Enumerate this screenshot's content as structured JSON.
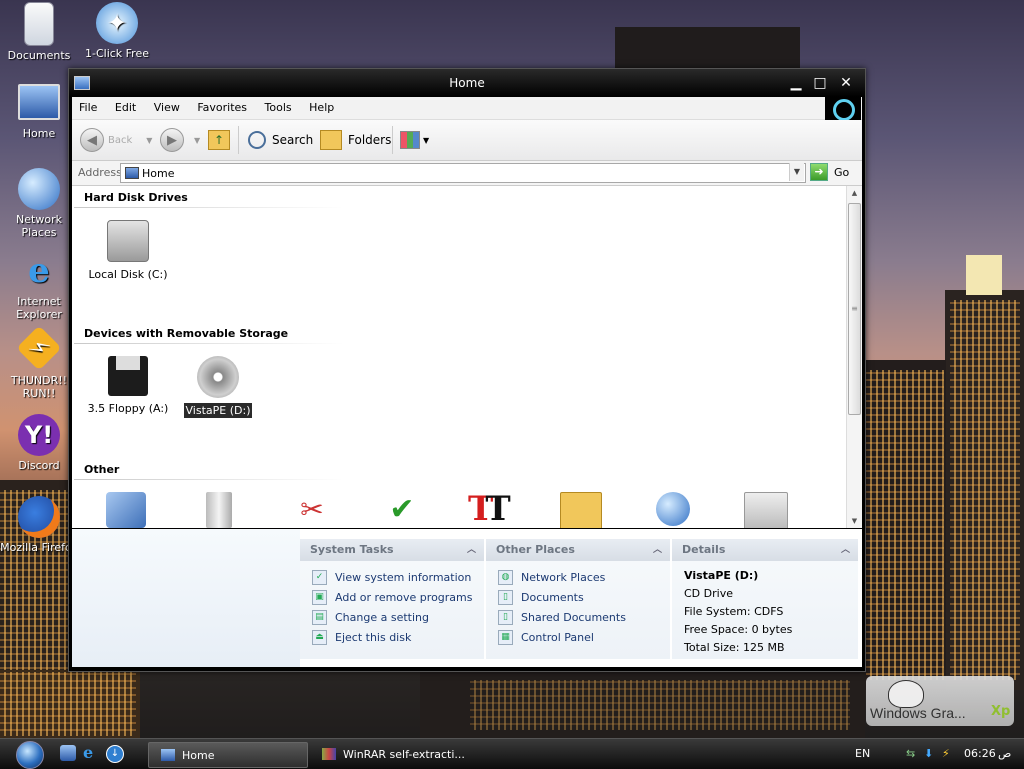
{
  "desktop": {
    "icons": [
      {
        "label": "Documents"
      },
      {
        "label": "1-Click Free"
      },
      {
        "label": "Home"
      },
      {
        "label": "Network Places"
      },
      {
        "label": "Internet Explorer"
      },
      {
        "label": "THUNDR!! RUN!!"
      },
      {
        "label": "Discord"
      },
      {
        "label": "Mozilla Firefox"
      }
    ],
    "watermark": {
      "text": "Windows Gra...",
      "xp": "Xp"
    }
  },
  "window": {
    "title": "Home",
    "controls": {
      "minimize": "▁",
      "maximize": "□",
      "close": "✕"
    },
    "menu": [
      "File",
      "Edit",
      "View",
      "Favorites",
      "Tools",
      "Help"
    ],
    "toolbar": {
      "back": "Back",
      "search": "Search",
      "folders": "Folders"
    },
    "address": {
      "label": "Address",
      "value": "Home",
      "go": "Go"
    },
    "sections": [
      {
        "title": "Hard Disk Drives",
        "items": [
          {
            "label": "Local Disk (C:)",
            "icon": "hard-disk-icon"
          }
        ]
      },
      {
        "title": "Devices with Removable Storage",
        "items": [
          {
            "label": "3.5 Floppy (A:)",
            "icon": "floppy-icon"
          },
          {
            "label": "VistaPE (D:)",
            "icon": "cd-drive-icon",
            "selected": true
          }
        ]
      },
      {
        "title": "Other",
        "items": [
          {
            "icon": "control-panel-icon"
          },
          {
            "icon": "recycle-bin-icon"
          },
          {
            "icon": "tools-icon"
          },
          {
            "icon": "checkmark-icon"
          },
          {
            "icon": "fonts-icon"
          },
          {
            "icon": "shared-folder-icon"
          },
          {
            "icon": "network-globe-icon"
          },
          {
            "icon": "printer-icon"
          }
        ]
      }
    ],
    "system_tasks": {
      "title": "System Tasks",
      "items": [
        "View system information",
        "Add or remove programs",
        "Change a setting",
        "Eject this disk"
      ]
    },
    "other_places": {
      "title": "Other Places",
      "items": [
        "Network Places",
        "Documents",
        "Shared Documents",
        "Control Panel"
      ]
    },
    "details": {
      "title": "Details",
      "name": "VistaPE (D:)",
      "type": "CD Drive",
      "file_system": "File System: CDFS",
      "free_space": "Free Space: 0 bytes",
      "total_size": "Total Size: 125 MB"
    }
  },
  "taskbar": {
    "tasks": [
      {
        "label": "Home",
        "active": true
      },
      {
        "label": "WinRAR self-extracti...",
        "active": false
      }
    ],
    "language": "EN",
    "clock": "06:26",
    "clock_suffix": "ص"
  },
  "colors": {
    "accent": "#2d6fc0",
    "panel_header": "#d7dde5",
    "link": "#1c3a72"
  }
}
